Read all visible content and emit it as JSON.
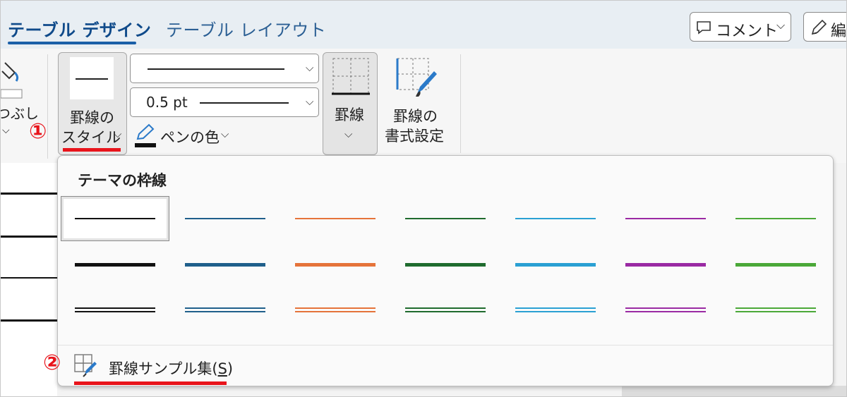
{
  "tabs": {
    "design": "テーブル デザイン",
    "layout": "テーブル レイアウト"
  },
  "top_buttons": {
    "comment": "コメント",
    "edit": "編"
  },
  "ribbon": {
    "left_partial_label": "つぶし",
    "border_style_line1": "罫線の",
    "border_style_line2": "スタイル",
    "weight_value": "0.5 pt",
    "pen_color": "ペンの色",
    "borders": "罫線",
    "border_format_line1": "罫線の",
    "border_format_line2": "書式設定"
  },
  "callouts": {
    "one": "①",
    "two": "②"
  },
  "panel": {
    "title": "テーマの枠線",
    "footer_text": "罫線サンプル集(",
    "footer_key": "S",
    "footer_close": ")",
    "colors": [
      "#111111",
      "#1f5f8b",
      "#e5733a",
      "#1f6b2e",
      "#2aa0d3",
      "#9a2aa3",
      "#4aa838"
    ]
  },
  "colors": {
    "accent_red": "#e8141b",
    "tab_blue": "#0f4a8a"
  },
  "icons": [
    "pen-icon",
    "comment-icon",
    "edit-pencil-icon",
    "border-grid-icon",
    "border-format-icon",
    "border-sample-icon",
    "chevron-down-icon",
    "fill-icon"
  ]
}
